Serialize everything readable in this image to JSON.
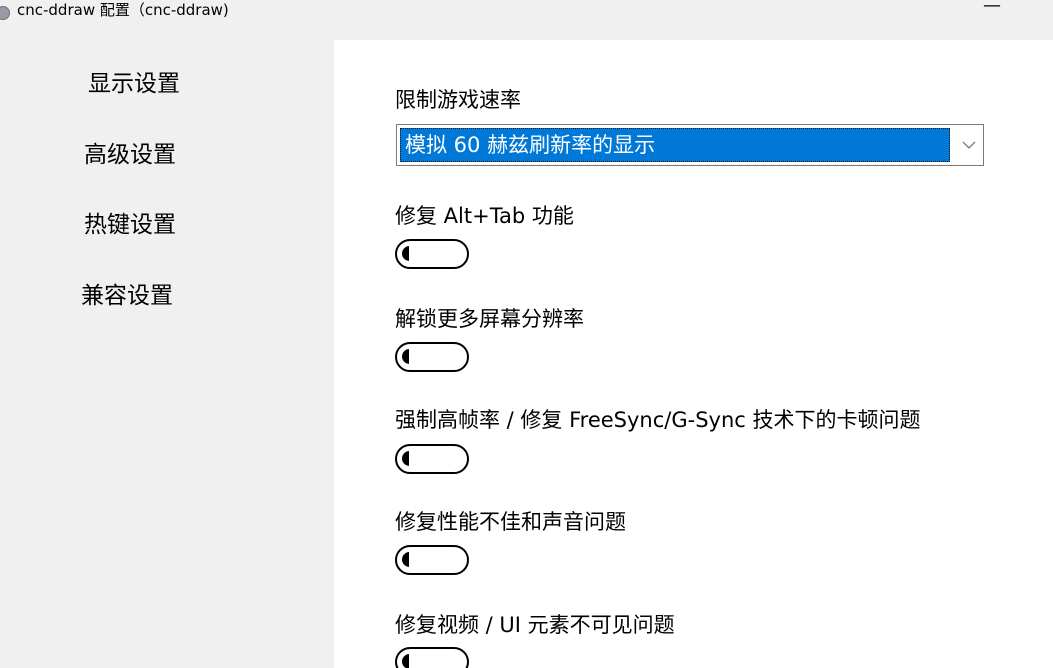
{
  "window": {
    "title": "cnc-ddraw 配置（cnc-ddraw)",
    "minimize_glyph": "—"
  },
  "sidebar": {
    "items": [
      {
        "label": "显示设置"
      },
      {
        "label": "高级设置"
      },
      {
        "label": "热键设置"
      },
      {
        "label": "兼容设置"
      }
    ]
  },
  "main": {
    "limit_fps": {
      "label": "限制游戏速率",
      "selected": "模拟 60 赫兹刷新率的显示"
    },
    "settings": [
      {
        "label": "修复 Alt+Tab 功能",
        "enabled": false
      },
      {
        "label": "解锁更多屏幕分辨率",
        "enabled": false
      },
      {
        "label": "强制高帧率 / 修复 FreeSync/G-Sync 技术下的卡顿问题",
        "enabled": false
      },
      {
        "label": "修复性能不佳和声音问题",
        "enabled": false
      },
      {
        "label": "修复视频 / UI 元素不可见问题",
        "enabled": false
      }
    ]
  },
  "icons": {
    "app": "app-gear-icon",
    "dropdown": "chevron-down-icon"
  },
  "colors": {
    "selection": "#0078d7",
    "window_background": "#f0f0f0",
    "panel_background": "#ffffff"
  }
}
